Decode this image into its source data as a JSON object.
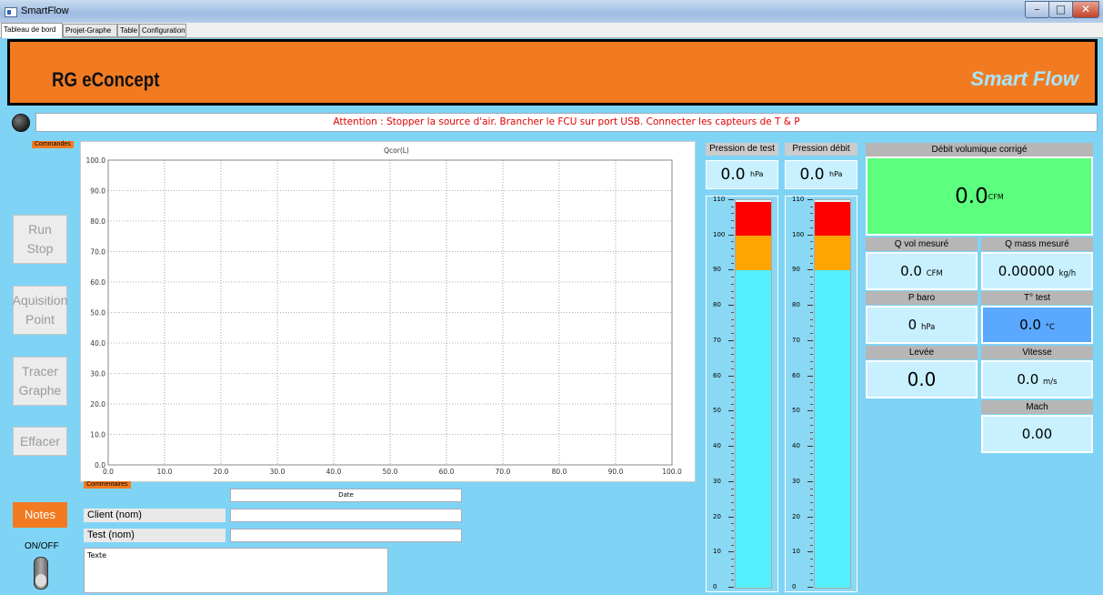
{
  "window": {
    "title": "SmartFlow",
    "min": "–",
    "max": "□",
    "close": "✕"
  },
  "tabs": [
    {
      "label": "Tableau de bord",
      "active": true
    },
    {
      "label": "Projet-Graphe"
    },
    {
      "label": "Table"
    },
    {
      "label": "Configuration"
    }
  ],
  "banner": {
    "brand": "RG eConcept",
    "product": "Smart Flow"
  },
  "status": {
    "message": "Attention : Stopper la source d'air. Brancher le FCU sur port USB. Connecter les capteurs de T & P"
  },
  "commands": {
    "tag": "Commandes",
    "run_stop": "Run\nStop",
    "acquisition": "Aquisition\nPoint",
    "tracer": "Tracer\nGraphe",
    "effacer": "Effacer",
    "notes": "Notes",
    "onoff": "ON/OFF"
  },
  "chart_data": {
    "type": "line",
    "title": "Qcor(L)",
    "xlim": [
      0,
      100
    ],
    "ylim": [
      0,
      100
    ],
    "x_ticks": [
      "0.0",
      "10.0",
      "20.0",
      "30.0",
      "40.0",
      "50.0",
      "60.0",
      "70.0",
      "80.0",
      "90.0",
      "100.0"
    ],
    "y_ticks": [
      "0.0",
      "10.0",
      "20.0",
      "30.0",
      "40.0",
      "50.0",
      "60.0",
      "70.0",
      "80.0",
      "90.0",
      "100.0"
    ],
    "grid": true,
    "series": []
  },
  "comments": {
    "tag": "Commentaires",
    "date_label": "Date",
    "client_label": "Client (nom)",
    "client_value": "",
    "test_label": "Test (nom)",
    "test_value": "",
    "notes_placeholder": "Texte"
  },
  "gauges": [
    {
      "title": "Pression de test",
      "value": "0.0",
      "unit": "hPa",
      "level": 0,
      "scale": [
        "110",
        "100",
        "90",
        "80",
        "70",
        "60",
        "50",
        "40",
        "30",
        "20",
        "10",
        "0"
      ]
    },
    {
      "title": "Pression débit",
      "value": "0.0",
      "unit": "hPa",
      "level": 0,
      "scale": [
        "110",
        "100",
        "90",
        "80",
        "70",
        "60",
        "50",
        "40",
        "30",
        "20",
        "10",
        "0"
      ]
    }
  ],
  "colors": {
    "accent": "#f27b22",
    "panel": "#7fd4f5",
    "value_bg": "#c8f0ff",
    "ok": "#5cff7e",
    "alarm": "#ff0000",
    "warn": "#ffa500",
    "gauge_fill": "#55f0ff",
    "temp": "#5aa8ff"
  },
  "measures": {
    "debit_title": "Débit volumique corrigé",
    "debit_value": "0.0",
    "debit_unit": "CFM",
    "qvol_title": "Q vol mesuré",
    "qvol_value": "0.0",
    "qvol_unit": "CFM",
    "qmass_title": "Q mass mesuré",
    "qmass_value": "0.00000",
    "qmass_unit": "kg/h",
    "pbaro_title": "P baro",
    "pbaro_value": "0",
    "pbaro_unit": "hPa",
    "ttest_title": "T° test",
    "ttest_value": "0.0",
    "ttest_unit": "°C",
    "levee_title": "Levée",
    "levee_value": "0.0",
    "vitesse_title": "Vitesse",
    "vitesse_value": "0.0",
    "vitesse_unit": "m/s",
    "mach_title": "Mach",
    "mach_value": "0.00"
  }
}
